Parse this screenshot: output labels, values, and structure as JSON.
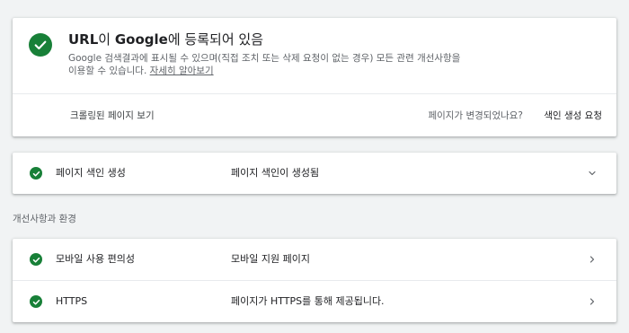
{
  "status_card": {
    "title_prefix": "URL",
    "title_mid": "이 ",
    "title_brand": "Google",
    "title_suffix": "에 등록되어 있음",
    "description": "Google 검색결과에 표시될 수 있으며(직접 조치 또는 삭제 요청이 없는 경우) 모든 관련 개선사항을 이용할 수 있습니다. ",
    "learn_more": "자세히 알아보기",
    "view_crawled": "크롤링된 페이지 보기",
    "changed_question": "페이지가 변경되었나요?",
    "request_indexing": "색인 생성 요청",
    "status_color": "#188038"
  },
  "indexing": {
    "label": "페이지 색인 생성",
    "value": "페이지 색인이 생성됨",
    "icon": "chevron-down-icon"
  },
  "enhancements": {
    "heading": "개선사항과 환경",
    "items": [
      {
        "label": "모바일 사용 편의성",
        "value": "모바일 지원 페이지",
        "icon": "chevron-right-icon"
      },
      {
        "label": "HTTPS",
        "value": "페이지가 HTTPS를 통해 제공됩니다.",
        "icon": "chevron-right-icon"
      }
    ]
  }
}
